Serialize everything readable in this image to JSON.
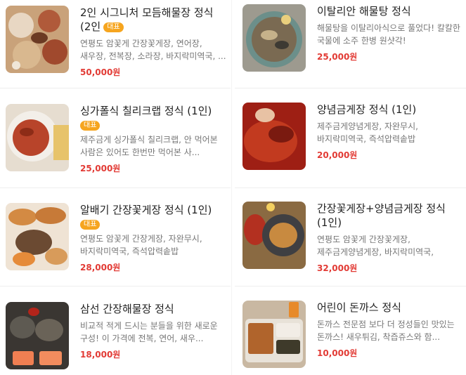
{
  "colors": {
    "price": "#e23b35",
    "badge_bg": "#f6a51f"
  },
  "menu": [
    {
      "title": "2인 시그니처 모듬해물장 정식 (2인",
      "badge": "대표",
      "desc": "연평도 암꽃게 간장꽃게장, 연어장, 새우장, 전복장, 소라장, 바지락미역국, ...",
      "price": "50,000원"
    },
    {
      "title": "이탈리안 해물탕 정식",
      "badge": "",
      "desc": "해물탕을 이탈리아식으로 풀었다! 칼칼한 국물에 소주 한병 원샷각!",
      "price": "25,000원"
    },
    {
      "title": "싱가폴식 칠리크랩 정식 (1인)",
      "badge": "대표",
      "desc": "제주금게 싱가폴식 칠리크랩, 안 먹어본 사람은 있어도 한번만 먹어본 사...",
      "price": "25,000원"
    },
    {
      "title": "양념금게장 정식 (1인)",
      "badge": "",
      "desc": "제주금게양념게장, 자완무시, 바지락미역국, 즉석압력솥밥",
      "price": "20,000원"
    },
    {
      "title": "알배기 간장꽃게장 정식 (1인)",
      "badge": "대표",
      "desc": "연평도 암꽃게 간장게장, 자완무시, 바지락미역국, 즉석압력솥밥",
      "price": "28,000원"
    },
    {
      "title": "간장꽃게장+양념금게장 정식 (1인)",
      "badge": "",
      "desc": "연평도 암꽃게 간장꽃게장, 제주금게양념게장, 바지락미역국, 즉석압력솥밥",
      "price": "32,000원"
    },
    {
      "title": "삼선 간장해물장 정식",
      "badge": "",
      "desc": "비교적 적게 드시는 분들을 위한 새로운 구성! 이 가격에 전복, 연어, 새우...",
      "price": "18,000원"
    },
    {
      "title": "어린이 돈까스 정식",
      "badge": "",
      "desc": "돈까스 전문점 보다 더 정성들인 맛있는 돈까스! 새우튀김, 착즙쥬스와 함...",
      "price": "10,000원"
    }
  ]
}
